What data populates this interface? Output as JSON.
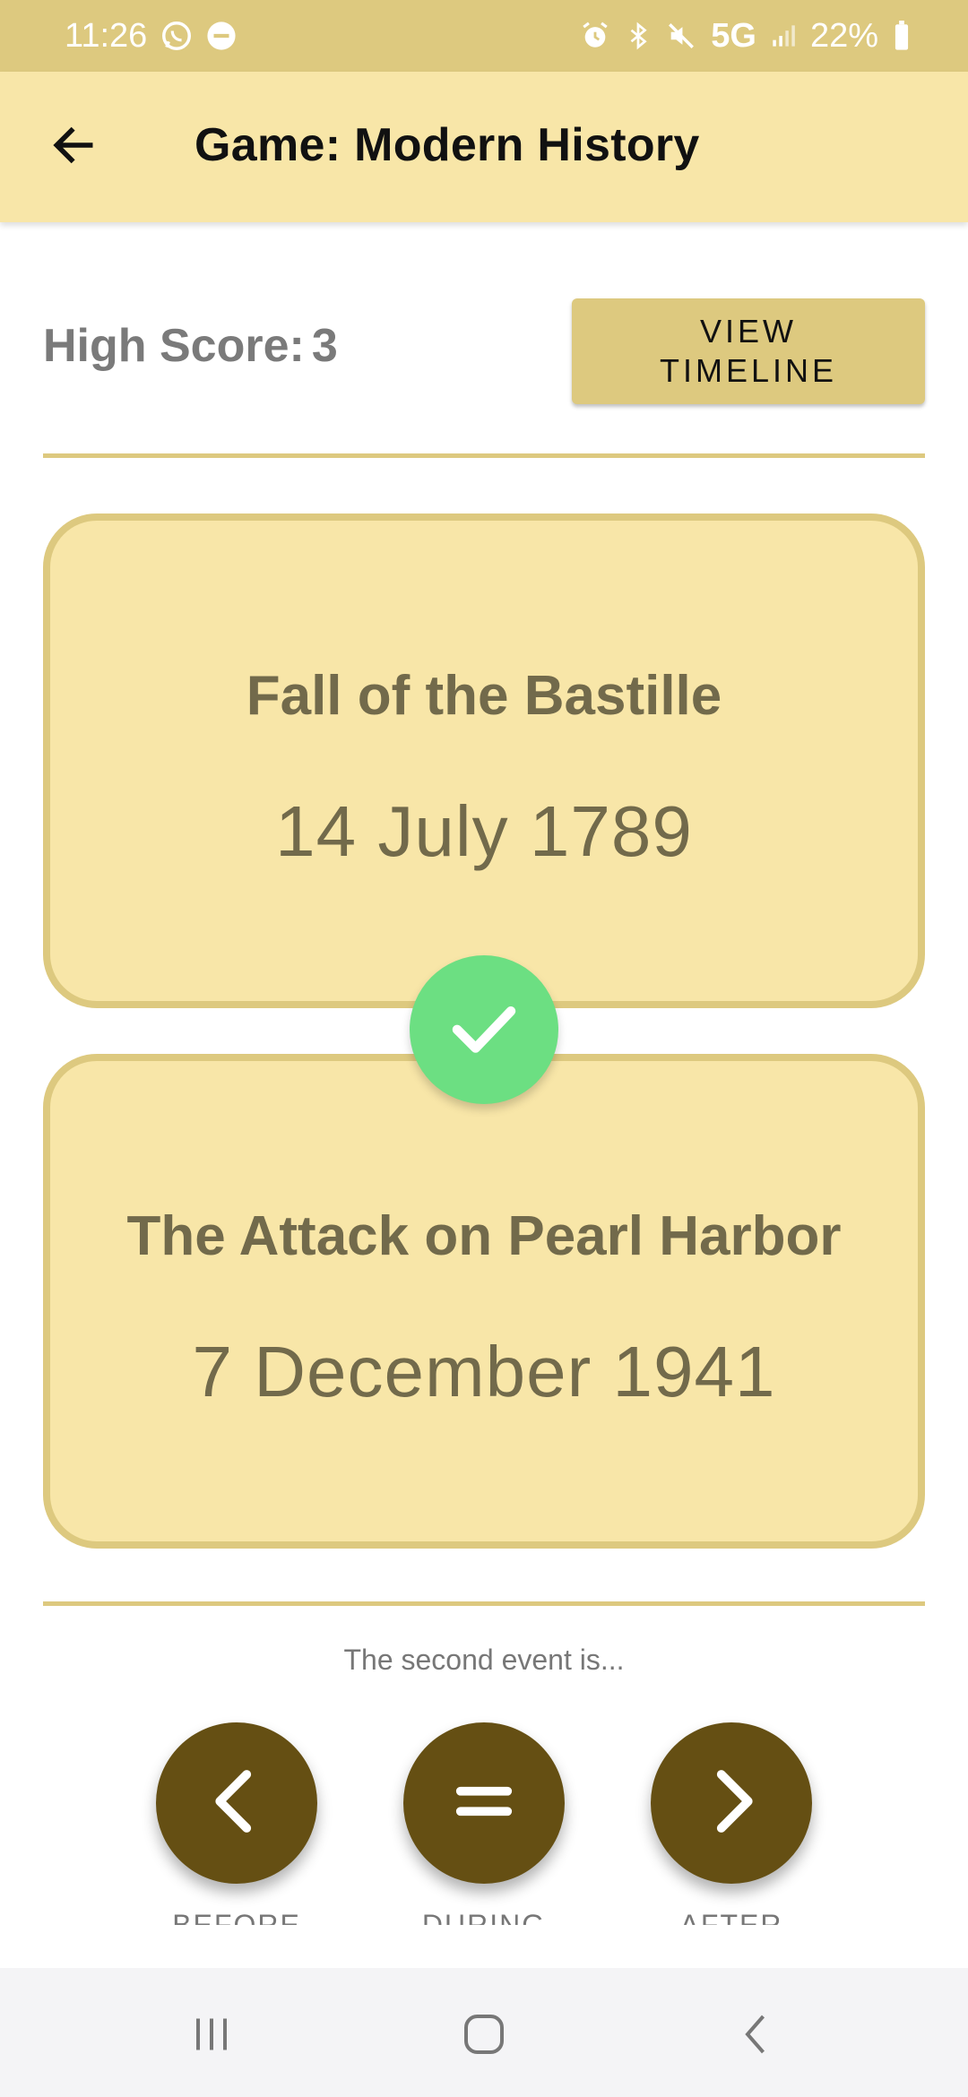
{
  "status_bar": {
    "time": "11:26",
    "network": "5G",
    "battery": "22%",
    "icons": [
      "whatsapp-icon",
      "do-not-disturb-icon",
      "alarm-icon",
      "bluetooth-icon",
      "mute-icon",
      "signal-icon",
      "battery-icon"
    ]
  },
  "app_bar": {
    "title": "Game: Modern History",
    "back_icon": "arrow-back-icon"
  },
  "score": {
    "label": "High Score:",
    "value": "3",
    "view_timeline_label": "VIEW TIMELINE"
  },
  "cards": [
    {
      "title": "Fall of the Bastille",
      "date": "14 July 1789"
    },
    {
      "title": "The Attack on Pearl Harbor",
      "date": "7 December 1941"
    }
  ],
  "result_icon": "check-icon",
  "prompt": "The second event is...",
  "answers": [
    {
      "label": "BEFORE",
      "icon": "chevron-left-icon"
    },
    {
      "label": "DURING",
      "icon": "equals-icon"
    },
    {
      "label": "AFTER",
      "icon": "chevron-right-icon"
    }
  ],
  "colors": {
    "status_bar": "#ddc97f",
    "app_bar": "#f8e6a8",
    "accent": "#ddc97f",
    "card_text": "#726a4b",
    "answer_button": "#654f13",
    "correct_badge": "#6cdf82"
  }
}
